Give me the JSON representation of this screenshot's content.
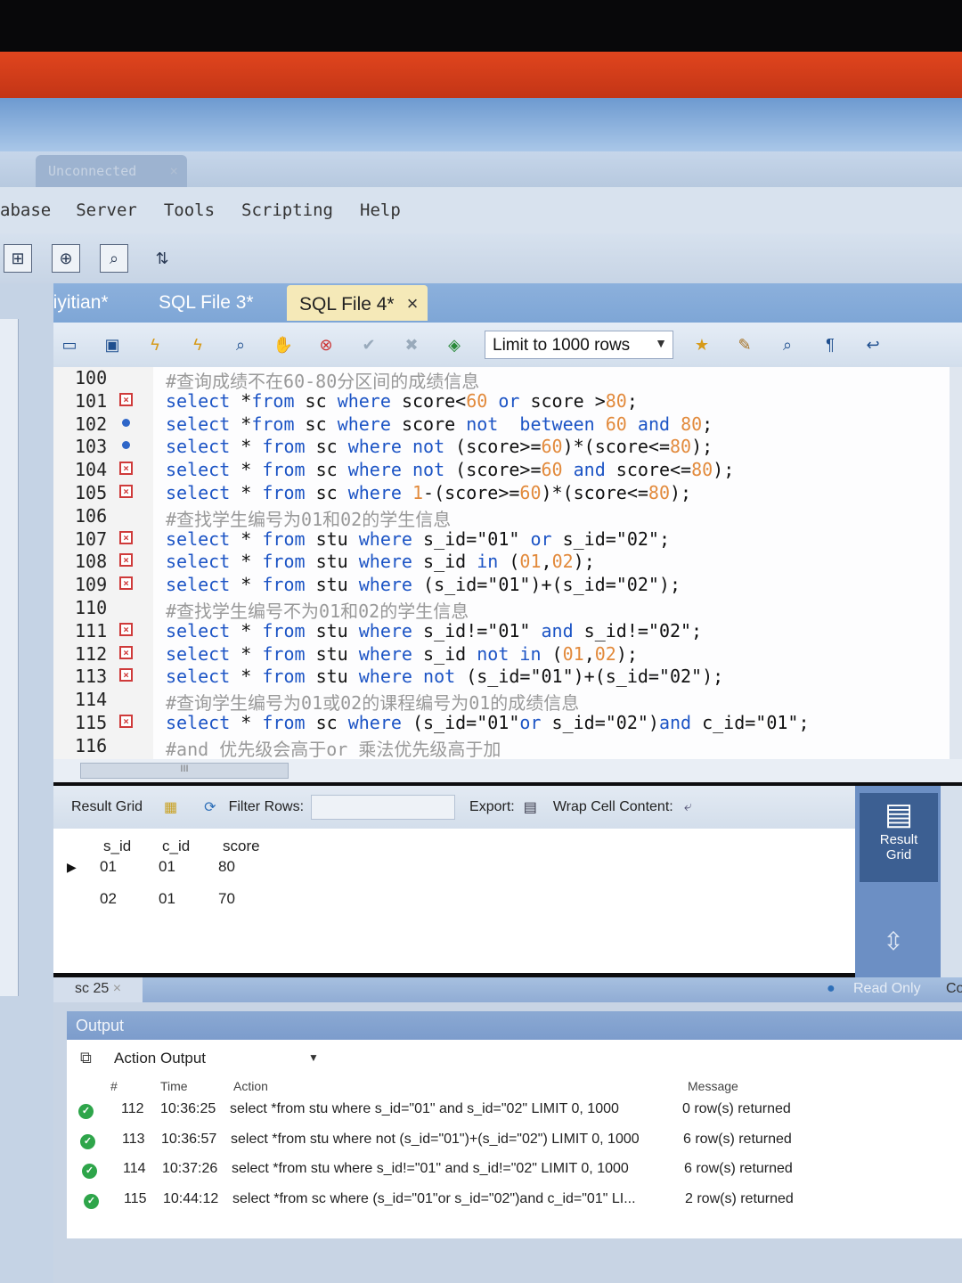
{
  "connection_tab": "Unconnected",
  "menu": [
    "abase",
    "Server",
    "Tools",
    "Scripting",
    "Help"
  ],
  "editor_tabs": [
    {
      "label": "diyitian*"
    },
    {
      "label": "SQL File 3*"
    },
    {
      "label": "SQL File 4*",
      "active": true
    }
  ],
  "toolbar2": {
    "limit_label": "Limit to 1000 rows"
  },
  "editor": {
    "lines": [
      {
        "n": "100",
        "mark": "",
        "code": "#查询成绩不在60-80分区间的成绩信息"
      },
      {
        "n": "101",
        "mark": "error",
        "code": "select *from sc where score<60 or score >80;"
      },
      {
        "n": "102",
        "mark": "dot",
        "code": "select *from sc where score not  between 60 and 80;"
      },
      {
        "n": "103",
        "mark": "dot",
        "code": "select * from sc where not (score>=60)*(score<=80);"
      },
      {
        "n": "104",
        "mark": "error",
        "code": "select * from sc where not (score>=60 and score<=80);"
      },
      {
        "n": "105",
        "mark": "error",
        "code": "select * from sc where 1-(score>=60)*(score<=80);"
      },
      {
        "n": "106",
        "mark": "",
        "code": "#查找学生编号为01和02的学生信息"
      },
      {
        "n": "107",
        "mark": "error",
        "code": "select * from stu where s_id=\"01\" or s_id=\"02\";"
      },
      {
        "n": "108",
        "mark": "error",
        "code": "select * from stu where s_id in (01,02);"
      },
      {
        "n": "109",
        "mark": "error",
        "code": "select * from stu where (s_id=\"01\")+(s_id=\"02\");"
      },
      {
        "n": "110",
        "mark": "",
        "code": "#查找学生编号不为01和02的学生信息"
      },
      {
        "n": "111",
        "mark": "error",
        "code": "select * from stu where s_id!=\"01\" and s_id!=\"02\";"
      },
      {
        "n": "112",
        "mark": "error",
        "code": "select * from stu where s_id not in (01,02);"
      },
      {
        "n": "113",
        "mark": "error",
        "code": "select * from stu where not (s_id=\"01\")+(s_id=\"02\");"
      },
      {
        "n": "114",
        "mark": "",
        "code": "#查询学生编号为01或02的课程编号为01的成绩信息"
      },
      {
        "n": "115",
        "mark": "error",
        "code": "select * from sc where (s_id=\"01\"or s_id=\"02\")and c_id=\"01\";"
      },
      {
        "n": "116",
        "mark": "",
        "code": "#and 优先级会高于or 乘法优先级高于加"
      }
    ]
  },
  "result_toolbar": {
    "result_grid": "Result Grid",
    "filter_rows": "Filter Rows:",
    "export": "Export:",
    "wrap": "Wrap Cell Content:"
  },
  "result": {
    "columns": [
      "s_id",
      "c_id",
      "score"
    ],
    "rows": [
      [
        "01",
        "01",
        "80"
      ],
      [
        "02",
        "01",
        "70"
      ]
    ]
  },
  "side_button": {
    "line1": "Result",
    "line2": "Grid"
  },
  "status": {
    "tab": "sc 25",
    "read_only": "Read Only",
    "right_cut": "Co"
  },
  "output": {
    "title": "Output",
    "mode": "Action Output",
    "headers": {
      "num": "#",
      "time": "Time",
      "action": "Action",
      "message": "Message"
    },
    "rows": [
      {
        "num": "112",
        "time": "10:36:25",
        "action": "select *from stu where s_id=\"01\" and s_id=\"02\" LIMIT 0, 1000",
        "message": "0 row(s) returned"
      },
      {
        "num": "113",
        "time": "10:36:57",
        "action": "select *from stu where not (s_id=\"01\")+(s_id=\"02\") LIMIT 0, 1000",
        "message": "6 row(s) returned"
      },
      {
        "num": "114",
        "time": "10:37:26",
        "action": "select *from stu where s_id!=\"01\" and s_id!=\"02\" LIMIT 0, 1000",
        "message": "6 row(s) returned"
      },
      {
        "num": "115",
        "time": "10:44:12",
        "action": "select *from sc where (s_id=\"01\"or s_id=\"02\")and c_id=\"01\" LI...",
        "message": "2 row(s) returned"
      }
    ]
  }
}
